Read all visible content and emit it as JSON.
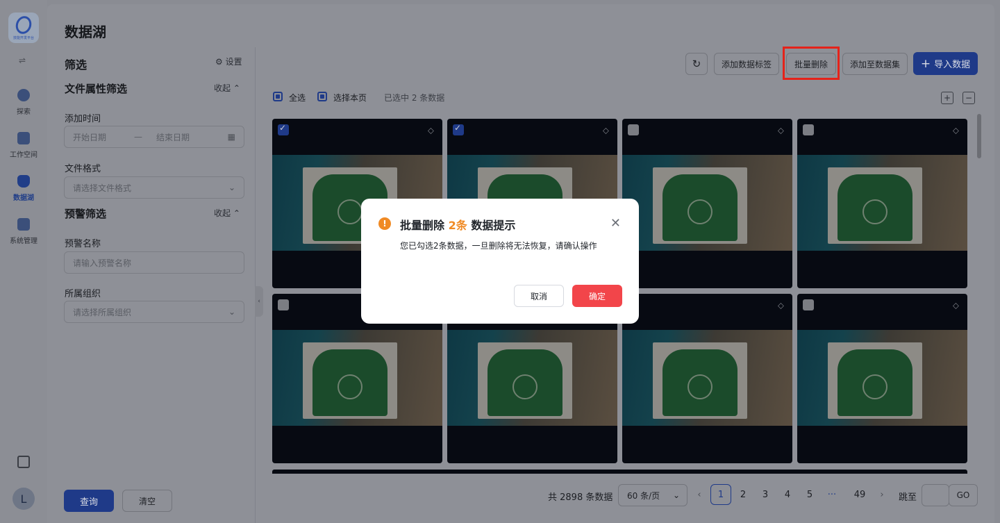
{
  "app": {
    "title": "数据湖",
    "logo_text": "技能开发平台"
  },
  "rail": {
    "items": [
      {
        "label": "探索"
      },
      {
        "label": "工作空间"
      },
      {
        "label": "数据湖"
      },
      {
        "label": "系统管理"
      }
    ],
    "avatar": "L"
  },
  "filter": {
    "title": "筛选",
    "settings": "设置",
    "section1": "文件属性筛选",
    "collapse": "收起",
    "add_time": "添加时间",
    "start_date": "开始日期",
    "end_date": "结束日期",
    "date_sep": "—",
    "file_format": "文件格式",
    "file_format_ph": "请选择文件格式",
    "section2": "预警筛选",
    "alert_name": "预警名称",
    "alert_name_ph": "请输入预警名称",
    "org": "所属组织",
    "org_ph": "请选择所属组织",
    "query": "查询",
    "clear": "清空"
  },
  "toolbar": {
    "add_tag": "添加数据标签",
    "batch_delete": "批量删除",
    "add_to_set": "添加至数据集",
    "import": "导入数据",
    "import_icon": "+",
    "select_all": "全选",
    "select_page": "选择本页",
    "selected_info": "已选中 2 条数据"
  },
  "cards": [
    {
      "checked": true
    },
    {
      "checked": true
    },
    {
      "checked": false
    },
    {
      "checked": false
    },
    {
      "checked": false
    },
    {
      "checked": false
    },
    {
      "checked": false
    },
    {
      "checked": false
    }
  ],
  "pagination": {
    "total": "共 2898 条数据",
    "page_size": "60 条/页",
    "pages": [
      "1",
      "2",
      "3",
      "4",
      "5",
      "···",
      "49"
    ],
    "current": "1",
    "jump_label": "跳至",
    "go": "GO"
  },
  "modal": {
    "title_pre": "批量删除",
    "title_count": "2条",
    "title_post": "数据提示",
    "message": "您已勾选2条数据，一旦删除将无法恢复，请确认操作",
    "cancel": "取消",
    "confirm": "确定",
    "warn_icon": "!"
  },
  "colors": {
    "primary": "#2f5ce0",
    "danger": "#f2454a",
    "warning": "#f08a24",
    "highlight_box": "#e5231a"
  }
}
